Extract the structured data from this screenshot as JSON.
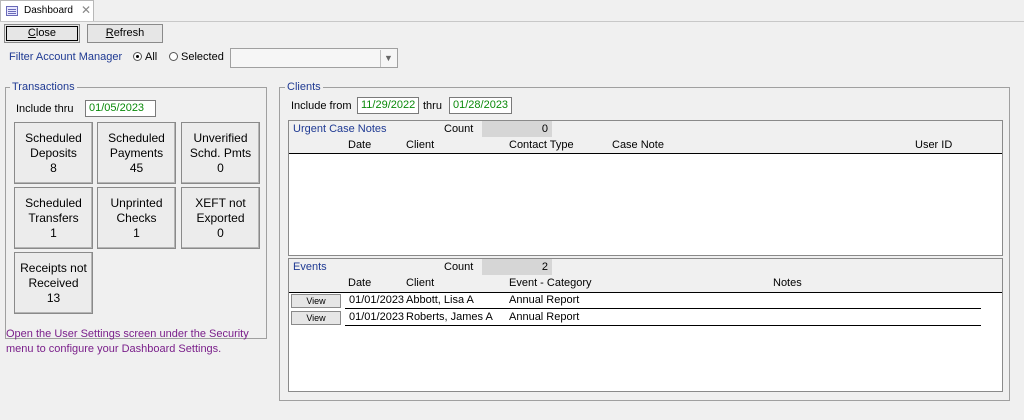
{
  "tab": {
    "label": "Dashboard",
    "close": "✕"
  },
  "toolbar": {
    "close_mnemonic": "C",
    "close_rest": "lose",
    "refresh_mnemonic": "R",
    "refresh_rest": "efresh"
  },
  "filter": {
    "label": "Filter Account Manager",
    "all_label": "All",
    "selected_label": "Selected",
    "selected_value": "",
    "dropdown_arrow": "▼"
  },
  "transactions": {
    "title": "Transactions",
    "include_thru_label": "Include thru",
    "include_thru_value": "01/05/2023",
    "tiles": [
      {
        "label": "Scheduled\nDeposits\n8"
      },
      {
        "label": "Scheduled\nPayments\n45"
      },
      {
        "label": "Unverified\nSchd. Pmts\n0"
      },
      {
        "label": "Scheduled\nTransfers\n1"
      },
      {
        "label": "Unprinted\nChecks\n1"
      },
      {
        "label": "XEFT not\nExported\n0"
      },
      {
        "label": "Receipts not\nReceived\n13"
      }
    ],
    "hint_line1": "Open the User Settings screen under the Security",
    "hint_line2": "menu to configure your Dashboard Settings."
  },
  "clients": {
    "title": "Clients",
    "include_from_label": "Include from",
    "include_from_value": "11/29/2022",
    "thru_label": "thru",
    "thru_value": "01/28/2023"
  },
  "case_notes": {
    "title": "Urgent Case Notes",
    "count_label": "Count",
    "count_value": "0",
    "columns": {
      "date": "Date",
      "client": "Client",
      "contact_type": "Contact Type",
      "case_note": "Case Note",
      "user_id": "User ID"
    }
  },
  "events": {
    "title": "Events",
    "count_label": "Count",
    "count_value": "2",
    "columns": {
      "date": "Date",
      "client": "Client",
      "category": "Event - Category",
      "notes": "Notes"
    },
    "rows": [
      {
        "view": "View",
        "date": "01/01/2023",
        "client": "Abbott, Lisa A",
        "category": "Annual Report",
        "notes": ""
      },
      {
        "view": "View",
        "date": "01/01/2023",
        "client": "Roberts, James A",
        "category": "Annual Report",
        "notes": ""
      }
    ]
  },
  "colors": {
    "accent": "#1f3a93",
    "date_green": "#0a8a0a",
    "hint_purple": "#7a1f8a"
  }
}
